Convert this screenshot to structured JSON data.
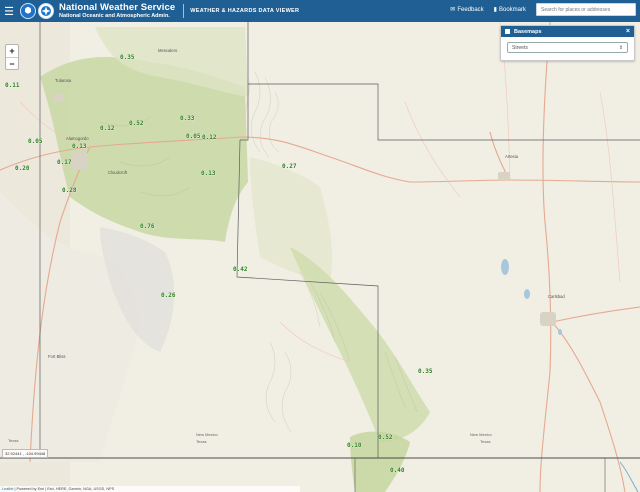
{
  "header": {
    "menu_icon": "hamburger-icon",
    "brand_title": "National Weather Service",
    "brand_subtitle": "National Oceanic and Atmospheric Admin.",
    "app_title": "WEATHER & HAZARDS DATA VIEWER",
    "feedback_label": "Feedback",
    "bookmark_label": "Bookmark",
    "search_placeholder": "Search for places or addresses"
  },
  "zoom": {
    "in": "+",
    "out": "−"
  },
  "basemaps": {
    "title": "Basemaps",
    "close": "×",
    "selected": "Streets"
  },
  "places": [
    {
      "name": "Alamogordo"
    },
    {
      "name": "Artesia"
    },
    {
      "name": "Carlsbad"
    },
    {
      "name": "Tularosa"
    },
    {
      "name": "Fort Bliss"
    },
    {
      "name": "Cloudcroft"
    },
    {
      "name": "Mescalero"
    },
    {
      "name": "New Mexico"
    },
    {
      "name": "Texas"
    }
  ],
  "precip_values": [
    "0.11",
    "0.35",
    "0.05",
    "0.13",
    "0.12",
    "0.52",
    "0.33",
    "0.05",
    "0.12",
    "0.17",
    "0.20",
    "0.13",
    "0.27",
    "0.28",
    "0.76",
    "0.42",
    "0.26",
    "0.35",
    "0.10",
    "0.52",
    "0.40"
  ],
  "colors": {
    "header_bg": "#1f5f93",
    "precip_label": "#2e7d1e",
    "terrain_green": "#c7d6a2",
    "county_line": "#555555"
  },
  "coords": "32.92441 , -104.99448",
  "attribution": {
    "leaflet": "Leaflet",
    "rest": " | Powered by Esri | Esri, HERE, Garmin, NGA, USGS, NPS"
  }
}
